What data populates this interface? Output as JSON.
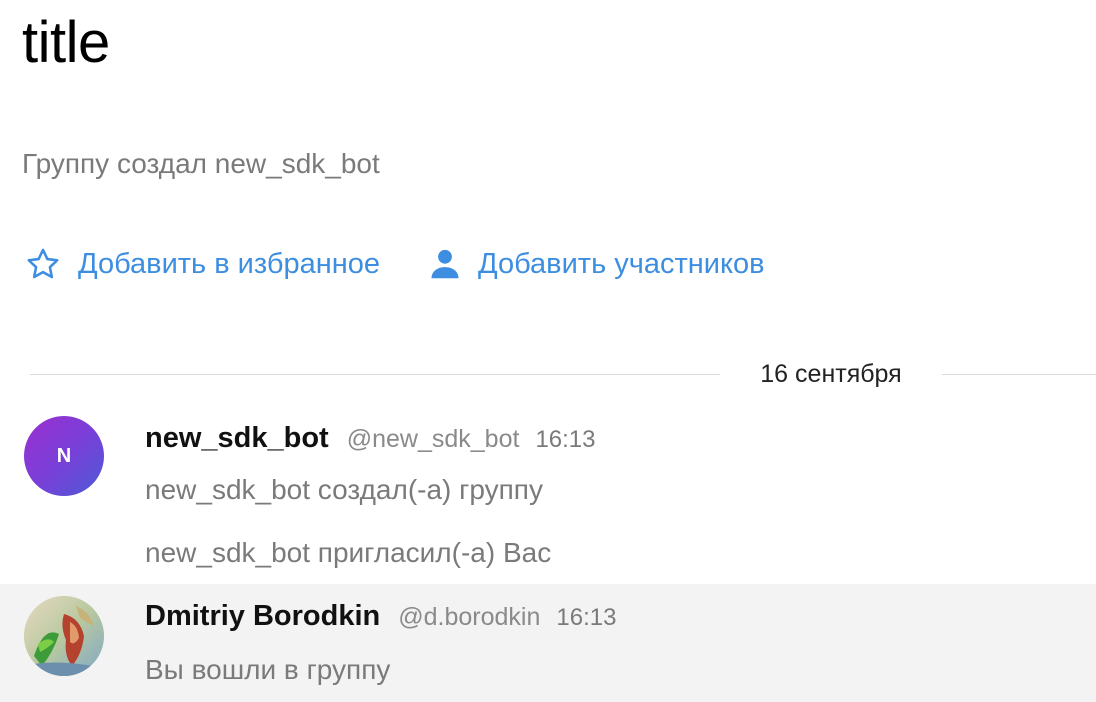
{
  "chat": {
    "title": "title",
    "subtitle": "Группу создал new_sdk_bot"
  },
  "actions": {
    "favorite": {
      "label": "Добавить в избранное",
      "icon": "star-outline-icon"
    },
    "add_members": {
      "label": "Добавить участников",
      "icon": "person-icon"
    }
  },
  "date_separator": "16 сентября",
  "messages": [
    {
      "avatar_letter": "N",
      "author": "new_sdk_bot",
      "handle": "@new_sdk_bot",
      "time": "16:13",
      "lines": [
        "new_sdk_bot создал(-а) группу",
        "new_sdk_bot пригласил(-а) Вас"
      ]
    },
    {
      "author": "Dmitriy Borodkin",
      "handle": "@d.borodkin",
      "time": "16:13",
      "lines": [
        "Вы вошли в группу"
      ]
    }
  ],
  "colors": {
    "accent": "#3d8ee0",
    "secondary_text": "#7a7a7a",
    "highlight_row": "#f3f3f3"
  }
}
